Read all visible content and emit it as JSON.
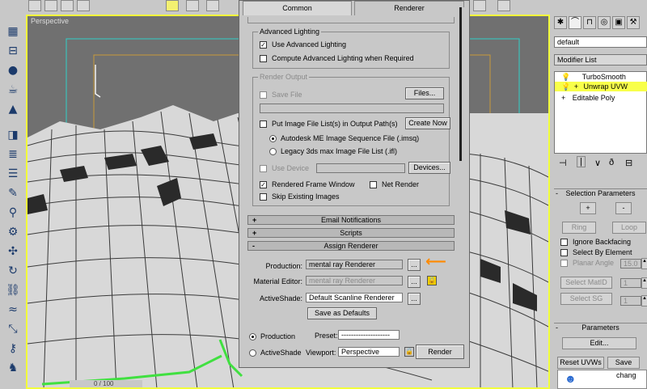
{
  "viewport": {
    "label": "Perspective",
    "frame_counter": "0 / 100"
  },
  "dialog": {
    "tabs": [
      "Common",
      "Renderer"
    ],
    "advanced_lighting": {
      "title": "Advanced Lighting",
      "use_label": "Use Advanced Lighting",
      "use_checked": true,
      "compute_label": "Compute Advanced Lighting when Required",
      "compute_checked": false
    },
    "render_output": {
      "title": "Render Output",
      "save_file_label": "Save File",
      "files_button": "Files...",
      "put_image_label": "Put Image File List(s) in Output Path(s)",
      "create_now_button": "Create Now",
      "radio_me": "Autodesk ME Image Sequence File (.imsq)",
      "radio_legacy": "Legacy 3ds max Image File List (.ifl)",
      "use_device_label": "Use Device",
      "devices_button": "Devices...",
      "rendered_frame_window_label": "Rendered Frame Window",
      "net_render_label": "Net Render",
      "skip_existing_label": "Skip Existing Images"
    },
    "rollouts": [
      {
        "sign": "+",
        "label": "Email Notifications"
      },
      {
        "sign": "+",
        "label": "Scripts"
      },
      {
        "sign": "-",
        "label": "Assign Renderer"
      }
    ],
    "assign_renderer": {
      "production_label": "Production:",
      "production_value": "mental ray Renderer",
      "material_editor_label": "Material Editor:",
      "material_editor_value": "mental ray Renderer",
      "activeshade_label": "ActiveShade:",
      "activeshade_value": "Default Scanline Renderer",
      "browse_button": "...",
      "save_defaults_button": "Save as Defaults"
    },
    "bottom": {
      "production_radio": "Production",
      "activeshade_radio": "ActiveShade",
      "preset_label": "Preset:",
      "preset_value": "--------------------",
      "viewport_label": "Viewport:",
      "viewport_value": "Perspective",
      "render_button": "Render"
    }
  },
  "right_panel": {
    "object_name": "default",
    "modifier_list": "Modifier List",
    "stack": [
      {
        "label": "TurboSmooth",
        "sign": ""
      },
      {
        "label": "Unwrap UVW",
        "sign": "+"
      },
      {
        "label": "Editable Poly",
        "sign": "+"
      }
    ],
    "selection_parameters": {
      "title": "Selection Parameters",
      "plus": "+",
      "minus": "-",
      "ring": "Ring",
      "loop": "Loop",
      "ignore_backfacing": "Ignore Backfacing",
      "select_by_element": "Select By Element",
      "planar_angle": "Planar Angle",
      "planar_angle_value": "15.0",
      "select_matid": "Select MatID",
      "select_matid_value": "1",
      "select_sg": "Select SG",
      "select_sg_value": "1"
    },
    "parameters": {
      "title": "Parameters",
      "edit_button": "Edit...",
      "reset_uvws": "Reset UVWs",
      "save": "Save",
      "channel_text": "chang"
    }
  }
}
